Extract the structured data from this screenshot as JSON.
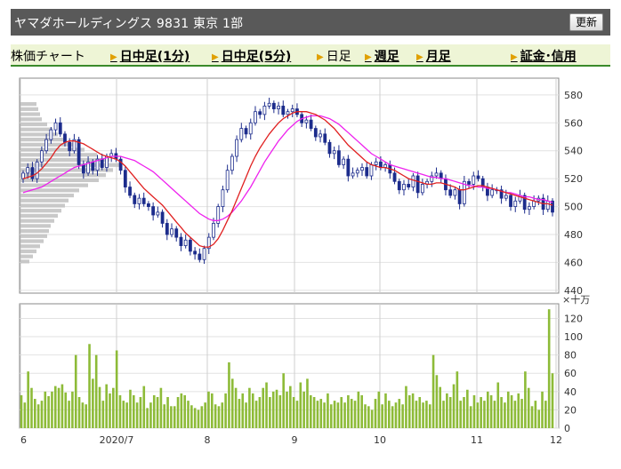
{
  "title": "ヤマダホールディングス  9831  東京 1部",
  "refresh_label": "更新",
  "tabs": [
    {
      "label": "株価チャート",
      "link": false,
      "arrow": false
    },
    {
      "label": "日中足(1分)",
      "link": true,
      "arrow": true
    },
    {
      "label": "日中足(5分)",
      "link": true,
      "arrow": true
    },
    {
      "label": "日足",
      "link": false,
      "arrow": true
    },
    {
      "label": "週足",
      "link": true,
      "arrow": true
    },
    {
      "label": "月足",
      "link": true,
      "arrow": true
    },
    {
      "label": "証金･信用",
      "link": true,
      "arrow": true
    }
  ],
  "colors": {
    "up": "#ffffff",
    "down": "#1c2c8c",
    "ma_short": "#e02020",
    "ma_long": "#ee22ee",
    "volume": "#8dbb38",
    "volume_profile": "#bfbfbf"
  },
  "chart_data": [
    {
      "type": "candlestick",
      "title": "",
      "x_tick_labels": [
        "6",
        "2020/7",
        "8",
        "9",
        "10",
        "11",
        "12"
      ],
      "y_tick_labels": [
        "440",
        "460",
        "480",
        "500",
        "520",
        "540",
        "560",
        "580"
      ],
      "ylim": [
        438,
        592
      ],
      "grid": true,
      "close": [
        524,
        528,
        520,
        532,
        540,
        548,
        555,
        560,
        552,
        546,
        540,
        548,
        530,
        524,
        532,
        526,
        534,
        528,
        536,
        538,
        534,
        526,
        514,
        508,
        502,
        506,
        502,
        500,
        494,
        496,
        488,
        480,
        484,
        478,
        472,
        476,
        468,
        466,
        462,
        470,
        478,
        488,
        500,
        512,
        526,
        536,
        548,
        556,
        552,
        560,
        568,
        566,
        572,
        574,
        570,
        572,
        566,
        568,
        570,
        566,
        560,
        562,
        556,
        550,
        552,
        546,
        538,
        540,
        530,
        534,
        522,
        524,
        526,
        528,
        522,
        530,
        532,
        528,
        530,
        524,
        518,
        512,
        516,
        514,
        522,
        510,
        516,
        518,
        522,
        524,
        520,
        512,
        508,
        512,
        502,
        518,
        516,
        522,
        520,
        514,
        508,
        512,
        512,
        506,
        508,
        500,
        504,
        508,
        498,
        500,
        504,
        506,
        498,
        504,
        496
      ],
      "open": [
        520,
        524,
        528,
        520,
        532,
        540,
        548,
        555,
        560,
        552,
        546,
        540,
        548,
        530,
        524,
        532,
        526,
        534,
        528,
        536,
        538,
        534,
        526,
        514,
        508,
        502,
        506,
        502,
        500,
        494,
        496,
        488,
        480,
        484,
        478,
        472,
        476,
        468,
        466,
        462,
        470,
        478,
        488,
        500,
        512,
        526,
        536,
        548,
        556,
        552,
        560,
        568,
        566,
        572,
        574,
        570,
        572,
        566,
        568,
        570,
        566,
        560,
        562,
        556,
        550,
        552,
        546,
        538,
        540,
        530,
        534,
        522,
        524,
        526,
        528,
        522,
        530,
        532,
        528,
        530,
        524,
        518,
        512,
        516,
        514,
        522,
        510,
        516,
        518,
        522,
        524,
        520,
        512,
        508,
        512,
        502,
        518,
        516,
        522,
        520,
        514,
        508,
        512,
        512,
        506,
        508,
        500,
        504,
        508,
        498,
        500,
        504,
        506,
        498,
        504
      ],
      "ma_short": [
        520,
        521,
        522,
        524,
        527,
        531,
        535,
        540,
        544,
        546,
        547,
        547,
        546,
        545,
        543,
        541,
        539,
        537,
        536,
        535,
        534,
        532,
        529,
        525,
        521,
        517,
        513,
        510,
        507,
        504,
        501,
        497,
        493,
        489,
        485,
        481,
        478,
        475,
        472,
        471,
        471,
        473,
        477,
        483,
        490,
        497,
        505,
        513,
        521,
        529,
        536,
        542,
        547,
        552,
        556,
        560,
        563,
        565,
        567,
        568,
        568,
        568,
        567,
        566,
        564,
        562,
        559,
        556,
        552,
        548,
        544,
        541,
        538,
        535,
        532,
        530,
        529,
        528,
        528,
        527,
        526,
        524,
        522,
        520,
        519,
        518,
        517,
        516,
        516,
        517,
        517,
        516,
        515,
        514,
        512,
        512,
        513,
        514,
        515,
        515,
        514,
        513,
        512,
        511,
        510,
        509,
        508,
        507,
        506,
        505,
        504,
        503,
        502,
        502,
        501
      ],
      "ma_long": [
        510,
        511,
        512,
        513,
        514,
        516,
        518,
        520,
        522,
        524,
        526,
        528,
        529,
        530,
        531,
        532,
        533,
        534,
        535,
        536,
        536,
        536,
        535,
        534,
        533,
        531,
        529,
        527,
        525,
        522,
        519,
        516,
        513,
        510,
        507,
        504,
        501,
        498,
        495,
        493,
        491,
        490,
        490,
        491,
        493,
        496,
        500,
        504,
        509,
        514,
        520,
        526,
        532,
        537,
        542,
        547,
        551,
        555,
        558,
        561,
        563,
        564,
        565,
        565,
        565,
        564,
        563,
        561,
        559,
        556,
        553,
        550,
        547,
        544,
        541,
        538,
        536,
        534,
        532,
        530,
        529,
        528,
        527,
        526,
        525,
        524,
        523,
        522,
        521,
        521,
        520,
        520,
        519,
        518,
        517,
        516,
        515,
        515,
        514,
        514,
        513,
        513,
        512,
        511,
        510,
        510,
        509,
        508,
        507,
        507,
        506,
        505,
        505,
        504,
        503
      ]
    },
    {
      "type": "bar",
      "title": "",
      "y_unit": "×十万",
      "y_tick_labels": [
        "0",
        "20",
        "40",
        "60",
        "80",
        "100",
        "120"
      ],
      "ylim": [
        0,
        136
      ],
      "values": [
        36,
        28,
        62,
        44,
        32,
        26,
        30,
        40,
        35,
        40,
        46,
        44,
        48,
        39,
        30,
        40,
        80,
        34,
        28,
        26,
        92,
        54,
        80,
        45,
        30,
        48,
        38,
        44,
        85,
        36,
        30,
        28,
        42,
        36,
        28,
        34,
        46,
        22,
        28,
        36,
        34,
        44,
        26,
        34,
        24,
        24,
        34,
        38,
        36,
        30,
        25,
        22,
        20,
        24,
        28,
        40,
        38,
        26,
        24,
        28,
        38,
        72,
        54,
        44,
        32,
        38,
        28,
        44,
        38,
        30,
        34,
        44,
        50,
        34,
        40,
        42,
        36,
        60,
        40,
        46,
        34,
        30,
        50,
        40,
        54,
        36,
        34,
        30,
        32,
        28,
        38,
        26,
        30,
        28,
        34,
        28,
        36,
        32,
        30,
        40,
        36,
        26,
        24,
        20,
        32,
        40,
        26,
        38,
        30,
        24,
        28,
        32,
        26,
        46,
        36,
        38,
        30,
        34,
        28,
        30,
        26,
        80,
        58,
        45,
        30,
        38,
        34,
        48,
        62,
        30,
        34,
        42,
        24,
        36,
        28,
        34,
        30,
        40,
        36,
        30,
        50,
        34,
        28,
        40,
        36,
        30,
        38,
        32,
        62,
        44,
        24,
        30,
        20,
        40,
        30,
        130,
        60
      ]
    }
  ]
}
